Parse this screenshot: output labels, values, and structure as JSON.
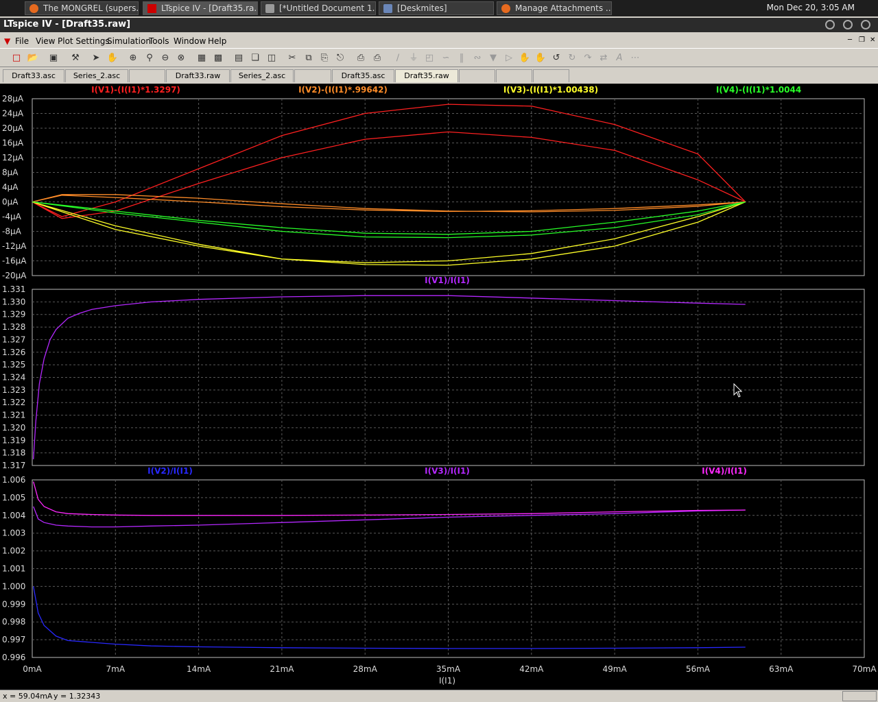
{
  "taskbar": {
    "tasks": [
      {
        "label": "The MONGREL (supers...",
        "icon": "firefox-icon"
      },
      {
        "label": "LTspice IV - [Draft35.ra...",
        "icon": "ltspice-icon"
      },
      {
        "label": "[*Untitled Document 1...",
        "icon": "text-editor-icon"
      },
      {
        "label": "[Deskmites]",
        "icon": "window-icon"
      },
      {
        "label": "Manage Attachments ...",
        "icon": "firefox-icon"
      }
    ],
    "clock": "Mon Dec 20,  3:05 AM"
  },
  "window": {
    "title": "LTspice IV - [Draft35.raw]"
  },
  "menu": [
    "File",
    "View",
    "Plot Settings",
    "Simulation",
    "Tools",
    "Window",
    "Help"
  ],
  "tabs": [
    "Draft33.asc",
    "Series_2.asc",
    "",
    "Draft33.raw",
    "Series_2.asc",
    "",
    "Draft35.asc",
    "Draft35.raw",
    "",
    "",
    ""
  ],
  "active_tab": 7,
  "colors": {
    "red": "#ff2020",
    "orange": "#ff8c28",
    "yellow": "#ffff28",
    "green": "#28ff28",
    "violet": "#b428ff",
    "blue": "#2828ff",
    "magenta": "#ff28ff",
    "grid": "#5a5a5a"
  },
  "chart_data": [
    {
      "type": "line",
      "xlabel": "I(I1)",
      "xlim": [
        0,
        70
      ],
      "x_tick_labels": [
        "0mA",
        "7mA",
        "14mA",
        "21mA",
        "28mA",
        "35mA",
        "42mA",
        "49mA",
        "56mA",
        "63mA",
        "70mA"
      ],
      "ylim": [
        -20,
        28
      ],
      "y_tick_labels": [
        "28µA",
        "24µA",
        "20µA",
        "16µA",
        "12µA",
        "8µA",
        "4µA",
        "0µA",
        "-4µA",
        "-8µA",
        "-12µA",
        "-16µA",
        "-20µA"
      ],
      "series": [
        {
          "name": "I(V1)-(I(I1)*1.3297)",
          "color": "#ff2020",
          "x": [
            0,
            2.5,
            7,
            14,
            21,
            28,
            35,
            42,
            49,
            56,
            60,
            56,
            49,
            42,
            35,
            28,
            21,
            14,
            7,
            2.5,
            0
          ],
          "y": [
            0,
            -4.5,
            -2.5,
            5,
            12,
            17,
            19,
            17.5,
            14,
            6,
            0,
            13,
            21,
            26,
            26.5,
            24,
            18,
            9,
            0,
            -4,
            0
          ]
        },
        {
          "name": "I(V2)-(I(I1)*.99642)",
          "color": "#ff8c28",
          "x": [
            0,
            2.5,
            7,
            14,
            21,
            28,
            35,
            42,
            49,
            56,
            60,
            56,
            49,
            42,
            35,
            28,
            21,
            14,
            7,
            2.5,
            0
          ],
          "y": [
            0,
            2,
            2,
            1,
            -0.5,
            -1.8,
            -2.5,
            -2.7,
            -2.3,
            -1.2,
            0,
            -0.8,
            -1.8,
            -2.4,
            -2.6,
            -2.2,
            -1.3,
            0,
            1.2,
            1.8,
            0
          ]
        },
        {
          "name": "I(V3)-(I(I1)*1.00438)",
          "color": "#ffff28",
          "x": [
            0,
            7,
            14,
            21,
            28,
            35,
            42,
            49,
            56,
            60,
            56,
            49,
            42,
            35,
            28,
            21,
            14,
            7,
            0
          ],
          "y": [
            0,
            -7.5,
            -12,
            -15.5,
            -17,
            -17.2,
            -15.5,
            -12,
            -5.5,
            0,
            -4,
            -10,
            -14,
            -16,
            -16.5,
            -15.5,
            -11.5,
            -6.5,
            0
          ]
        },
        {
          "name": "I(V4)-(I(I1)*1.0044",
          "color": "#28ff28",
          "x": [
            0,
            7,
            14,
            21,
            28,
            35,
            42,
            49,
            56,
            60,
            56,
            49,
            42,
            35,
            28,
            21,
            14,
            7,
            0
          ],
          "y": [
            0,
            -3,
            -5.5,
            -8,
            -9.5,
            -9.7,
            -9,
            -7,
            -3.5,
            0,
            -2.5,
            -5.5,
            -8,
            -8.8,
            -8.5,
            -7,
            -5,
            -2.5,
            0
          ]
        }
      ]
    },
    {
      "type": "line",
      "xlim": [
        0,
        70
      ],
      "ylim": [
        1.317,
        1.331
      ],
      "y_tick_labels": [
        "1.331",
        "1.330",
        "1.329",
        "1.328",
        "1.327",
        "1.326",
        "1.325",
        "1.324",
        "1.323",
        "1.322",
        "1.321",
        "1.320",
        "1.319",
        "1.318",
        "1.317"
      ],
      "series": [
        {
          "name": "I(V1)/I(I1)",
          "color": "#b428ff",
          "x": [
            0.1,
            0.3,
            0.6,
            1,
            1.5,
            2,
            3,
            4,
            5,
            7,
            10,
            14,
            21,
            28,
            35,
            42,
            49,
            56,
            60
          ],
          "y": [
            1.3175,
            1.3205,
            1.3235,
            1.3255,
            1.327,
            1.3278,
            1.3287,
            1.3291,
            1.3294,
            1.3297,
            1.33,
            1.3302,
            1.3304,
            1.3305,
            1.3305,
            1.3303,
            1.3301,
            1.3299,
            1.3298
          ]
        }
      ]
    },
    {
      "type": "line",
      "xlim": [
        0,
        70
      ],
      "ylim": [
        0.996,
        1.006
      ],
      "y_tick_labels": [
        "1.006",
        "1.005",
        "1.004",
        "1.003",
        "1.002",
        "1.001",
        "1.000",
        "0.999",
        "0.998",
        "0.997",
        "0.996"
      ],
      "series": [
        {
          "name": "I(V2)/I(I1)",
          "color": "#2828ff",
          "x": [
            0.1,
            0.5,
            1,
            2,
            3,
            5,
            7,
            10,
            14,
            21,
            28,
            35,
            42,
            49,
            56,
            60
          ],
          "y": [
            1.0,
            0.9985,
            0.9978,
            0.9972,
            0.99695,
            0.99685,
            0.99675,
            0.99665,
            0.9966,
            0.99655,
            0.99652,
            0.9965,
            0.9965,
            0.99652,
            0.99655,
            0.99658
          ]
        },
        {
          "name": "I(V3)/I(I1)",
          "color": "#b428ff",
          "x": [
            0.1,
            0.5,
            1,
            2,
            3,
            5,
            7,
            10,
            14,
            21,
            28,
            35,
            42,
            49,
            56,
            60
          ],
          "y": [
            1.0045,
            1.0038,
            1.0036,
            1.00345,
            1.0034,
            1.00335,
            1.00335,
            1.0034,
            1.00345,
            1.0036,
            1.00375,
            1.0039,
            1.004,
            1.0041,
            1.00425,
            1.0043
          ]
        },
        {
          "name": "I(V4)/I(I1)",
          "color": "#ff28ff",
          "x": [
            0.1,
            0.5,
            1,
            2,
            3,
            5,
            7,
            10,
            14,
            21,
            28,
            35,
            42,
            49,
            56,
            60
          ],
          "y": [
            1.0059,
            1.0049,
            1.0045,
            1.0042,
            1.0041,
            1.00405,
            1.00402,
            1.004,
            1.004,
            1.004,
            1.00402,
            1.00405,
            1.0041,
            1.0042,
            1.00428,
            1.0043
          ]
        }
      ]
    }
  ],
  "status": {
    "x": "x = 59.04mA",
    "y": "y = 1.32343"
  }
}
